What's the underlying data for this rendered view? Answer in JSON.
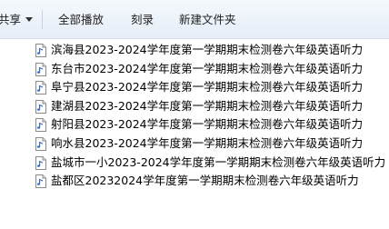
{
  "toolbar": {
    "share_label": "共享",
    "play_all_label": "全部播放",
    "burn_label": "刻录",
    "new_folder_label": "新建文件夹"
  },
  "files": [
    {
      "name": "滨海县2023-2024学年度第一学期期末检测卷六年级英语听力",
      "icon": "audio-file-icon"
    },
    {
      "name": "东台市2023-2024学年度第一学期期末检测卷六年级英语听力",
      "icon": "audio-file-icon"
    },
    {
      "name": "阜宁县2023-2024学年度第一学期期末检测卷六年级英语听力",
      "icon": "audio-file-icon"
    },
    {
      "name": "建湖县2023-2024学年度第一学期期末检测卷六年级英语听力",
      "icon": "audio-file-icon"
    },
    {
      "name": "射阳县2023-2024学年度第一学期期末检测卷六年级英语听力",
      "icon": "audio-file-icon"
    },
    {
      "name": "响水县2023-2024学年度第一学期期末检测卷六年级英语听力",
      "icon": "audio-file-icon"
    },
    {
      "name": "盐城市一小2023-2024学年度第一学期期末检测卷六年级英语听力",
      "icon": "audio-file-icon"
    },
    {
      "name": "盐都区20232024学年度第一学期期末检测卷六年级英语听力",
      "icon": "audio-file-icon"
    }
  ]
}
